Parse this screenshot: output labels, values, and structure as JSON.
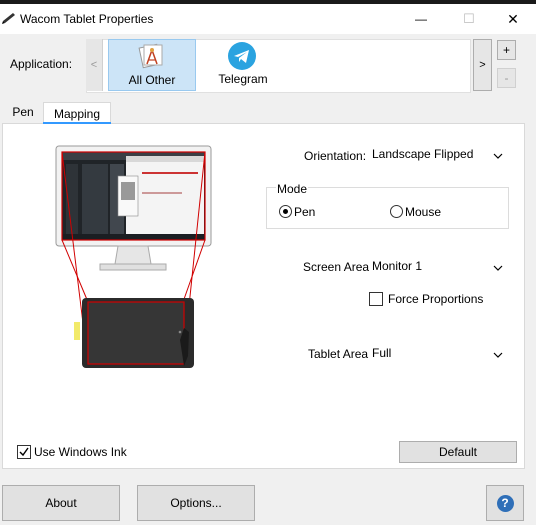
{
  "window": {
    "title": "Wacom Tablet Properties",
    "minimize_glyph": "—",
    "maximize_glyph": "☐",
    "close_glyph": "✕"
  },
  "application": {
    "label": "Application:",
    "scroll_left": "<",
    "scroll_right": ">",
    "add": "+",
    "remove": "-",
    "items": [
      {
        "label": "All Other",
        "icon": "all-other-icon",
        "selected": true
      },
      {
        "label": "Telegram",
        "icon": "telegram-icon",
        "selected": false
      }
    ]
  },
  "tabs": [
    {
      "label": "Pen",
      "active": false
    },
    {
      "label": "Mapping",
      "active": true
    }
  ],
  "mapping": {
    "orientation_label": "Orientation:",
    "orientation_value": "Landscape Flipped",
    "mode_label": "Mode",
    "mode_pen": "Pen",
    "mode_mouse": "Mouse",
    "mode_selected": "Pen",
    "screen_area_label": "Screen Area:",
    "screen_area_value": "Monitor 1",
    "force_proportions": "Force Proportions",
    "force_proportions_checked": false,
    "tablet_area_label": "Tablet Area:",
    "tablet_area_value": "Full",
    "use_windows_ink": "Use Windows Ink",
    "use_windows_ink_checked": true,
    "default_button": "Default"
  },
  "footer": {
    "about": "About",
    "options": "Options...",
    "help_glyph": "?"
  },
  "colors": {
    "accent": "#3399ff",
    "selected_tile": "#cce4f7",
    "map_line": "#d10000",
    "telegram": "#2aa3e0"
  }
}
